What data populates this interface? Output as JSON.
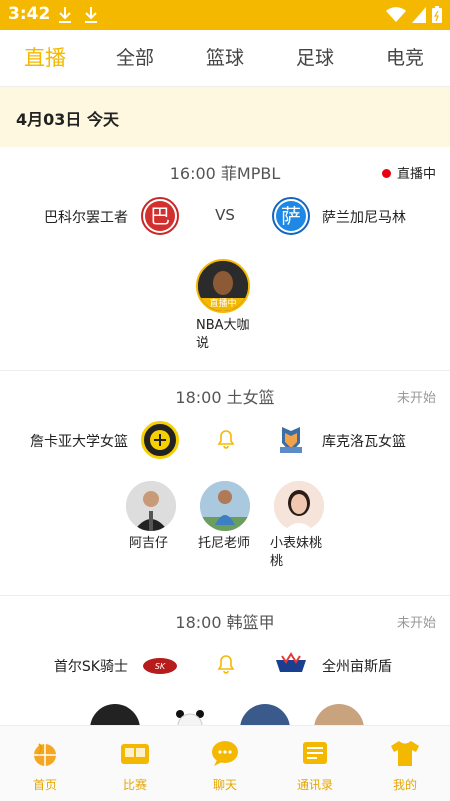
{
  "status_bar": {
    "time": "3:42"
  },
  "tabs": [
    {
      "label": "直播"
    },
    {
      "label": "全部"
    },
    {
      "label": "篮球"
    },
    {
      "label": "足球"
    },
    {
      "label": "电竞"
    }
  ],
  "date_header": "4月03日 今天",
  "matches": [
    {
      "time_league": "16:00 菲MPBL",
      "status": "直播中",
      "home": {
        "name": "巴科尔罢工者",
        "logo_char": "巴"
      },
      "vs": "VS",
      "away": {
        "name": "萨兰加尼马林",
        "logo_char": "萨"
      },
      "anchors": [
        {
          "name": "NBA大咖说",
          "badge": "直播中"
        }
      ]
    },
    {
      "time_league": "18:00 土女篮",
      "status": "未开始",
      "home": {
        "name": "詹卡亚大学女篮"
      },
      "away": {
        "name": "库克洛瓦女篮"
      },
      "anchors": [
        {
          "name": "阿吉仔"
        },
        {
          "name": "托尼老师"
        },
        {
          "name": "小表妹桃桃"
        }
      ]
    },
    {
      "time_league": "18:00 韩篮甲",
      "status": "未开始",
      "home": {
        "name": "首尔SK骑士"
      },
      "away": {
        "name": "全州亩斯盾"
      }
    }
  ],
  "bottom_nav": [
    {
      "label": "首页"
    },
    {
      "label": "比赛"
    },
    {
      "label": "聊天"
    },
    {
      "label": "通讯录"
    },
    {
      "label": "我的"
    }
  ],
  "colors": {
    "accent": "#f5b800",
    "live_dot": "#e60012",
    "date_bg": "#fff8e1"
  }
}
